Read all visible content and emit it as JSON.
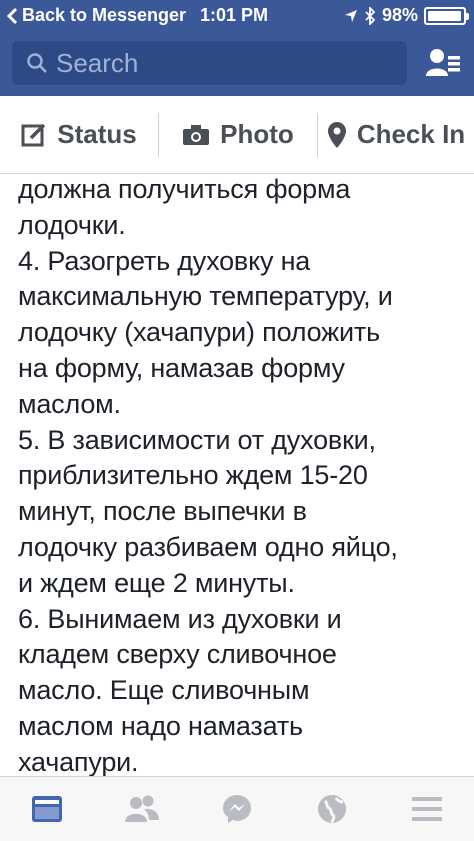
{
  "status_bar": {
    "back_label": "Back to Messenger",
    "time": "1:01 PM",
    "battery": "98%",
    "battery_level": 0.98
  },
  "search": {
    "placeholder": "Search"
  },
  "composer": {
    "status_label": "Status",
    "photo_label": "Photo",
    "checkin_label": "Check In"
  },
  "post": {
    "lines": [
      "должна получиться форма",
      "лодочки.",
      "4. Разогреть духовку на",
      "максимальную температуру, и",
      "лодочку (хачапури) положить",
      "на форму, намазав форму",
      "маслом.",
      "5. В зависимости от духовки,",
      "приблизительно ждем 15-20",
      "минут, после выпечки в",
      "лодочку разбиваем одно яйцо,",
      "и ждем еще 2 минуты.",
      "6. Вынимаем из духовки и",
      "кладем сверху сливочное",
      "масло. Еще сливочным",
      "маслом надо намазать",
      "хачапури."
    ]
  },
  "tabbar": {
    "tabs": [
      {
        "icon": "news-feed-icon",
        "active": true
      },
      {
        "icon": "friends-icon",
        "active": false
      },
      {
        "icon": "messenger-icon",
        "active": false
      },
      {
        "icon": "globe-icon",
        "active": false
      },
      {
        "icon": "menu-icon",
        "active": false
      }
    ]
  },
  "colors": {
    "brand": "#3b5998",
    "search_bg": "#2d4a86",
    "active_tab": "#4267b2",
    "inactive_tab": "#b9bcc2",
    "text": "#1d2129"
  }
}
